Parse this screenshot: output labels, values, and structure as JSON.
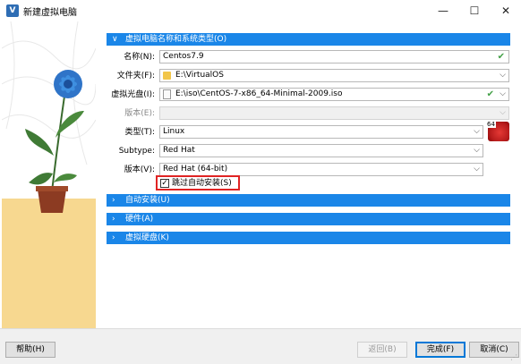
{
  "window": {
    "title": "新建虚拟电脑",
    "app_icon_text": "V",
    "minimize": "—",
    "maximize": "☐",
    "close": "✕"
  },
  "sections": {
    "name_os": {
      "label": "虚拟电脑名称和系统类型(O)",
      "expanded": true
    },
    "unattended": {
      "label": "自动安装(U)",
      "expanded": false
    },
    "hardware": {
      "label": "硬件(A)",
      "expanded": false
    },
    "hard_disk": {
      "label": "虚拟硬盘(K)",
      "expanded": false
    }
  },
  "form": {
    "name": {
      "label": "名称(N):",
      "value": "Centos7.9",
      "valid": true
    },
    "folder": {
      "label": "文件夹(F):",
      "value": "E:\\VirtualOS"
    },
    "iso": {
      "label": "虚拟光盘(I):",
      "value": "E:\\iso\\CentOS-7-x86_64-Minimal-2009.iso",
      "valid": true
    },
    "edition": {
      "label": "版本(E):",
      "value": "",
      "disabled": true
    },
    "type": {
      "label": "类型(T):",
      "value": "Linux"
    },
    "subtype": {
      "label": "Subtype:",
      "value": "Red Hat"
    },
    "version": {
      "label": "版本(V):",
      "value": "Red Hat (64-bit)"
    },
    "skip_unattended": {
      "label": "跳过自动安装(S)",
      "checked": true
    }
  },
  "os_icon": {
    "badge": "64",
    "name": "red-hat-os-icon"
  },
  "buttons": {
    "help": "帮助(H)",
    "back": "返回(B)",
    "finish": "完成(F)",
    "cancel": "取消(C)"
  },
  "colors": {
    "section_bar": "#1a86e8",
    "highlight_box": "#e02424",
    "valid_check": "#43a047",
    "banner_sand": "#f7d890"
  }
}
